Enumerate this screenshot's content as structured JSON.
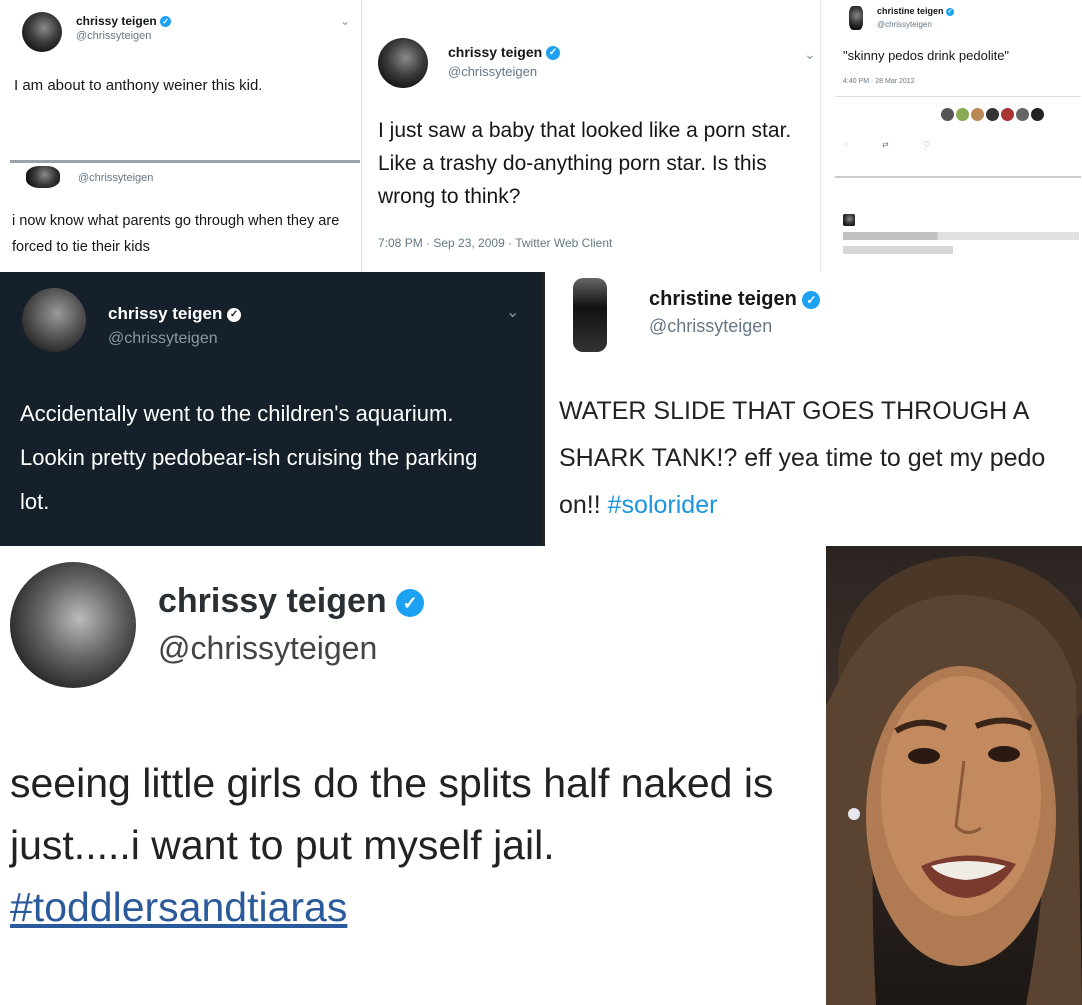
{
  "p1": {
    "name": "chrissy teigen",
    "handle": "@chrissyteigen",
    "text": "I am about to anthony weiner this kid.",
    "handle2": "@chrissyteigen",
    "text2": "i now know what parents go through when they are forced to tie their kids"
  },
  "p2": {
    "name": "chrissy teigen",
    "handle": "@chrissyteigen",
    "text": "I just saw a baby that looked like a porn star. Like a trashy do-anything porn star. Is this wrong to think?",
    "timestamp": "7:08 PM · Sep 23, 2009 · Twitter Web Client"
  },
  "p3": {
    "name": "christine teigen",
    "handle": "@chrissyteigen",
    "text": "\"skinny pedos drink pedolite\"",
    "date": "4:40 PM · 28 Mar 2012"
  },
  "p4": {
    "name": "chrissy teigen",
    "handle": "@chrissyteigen",
    "text": "Accidentally went to the children's aquarium. Lookin pretty pedobear-ish cruising the parking lot."
  },
  "p5": {
    "name": "christine teigen",
    "handle": "@chrissyteigen",
    "text": "WATER SLIDE THAT GOES THROUGH A SHARK TANK!? eff yea time to get my pedo on!!",
    "hashtag": "#solorider"
  },
  "p6": {
    "name": "chrissy teigen",
    "handle": "@chrissyteigen",
    "text": "seeing little girls do the splits half naked is just.....i want to put myself jail.",
    "hashtag": "#toddlersandtiaras"
  },
  "theme": {
    "dark_bg": "#15202b",
    "accent": "#1da1f2",
    "verified": "#1da1f2"
  }
}
